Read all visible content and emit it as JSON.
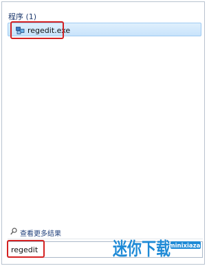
{
  "programs_section": {
    "title": "程序 (1)",
    "items": [
      {
        "label": "regedit.exe",
        "icon": "registry-editor-icon"
      }
    ]
  },
  "see_more": {
    "label": "查看更多结果",
    "icon": "magnifier-icon"
  },
  "search": {
    "value": "regedit"
  },
  "watermark": {
    "logo_text": "迷你下载",
    "site": "minixiazai"
  },
  "colors": {
    "highlight_border": "#d42020",
    "selection": "#c8e3fb",
    "watermark_blue": "#1e8ad6",
    "watermark_orange": "#e8731c"
  }
}
